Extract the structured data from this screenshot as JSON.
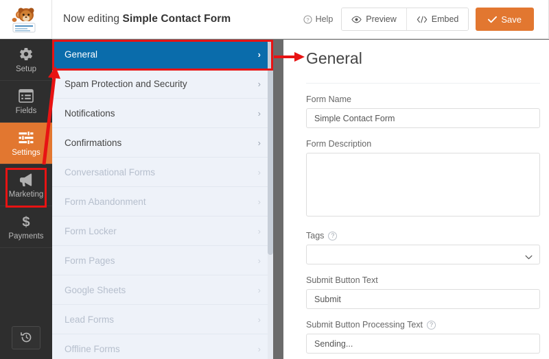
{
  "header": {
    "logo_alt": "wpforms-mascot-logo",
    "title_prefix": "Now editing ",
    "form_name": "Simple Contact Form",
    "help_label": "Help",
    "preview_label": "Preview",
    "embed_label": "Embed",
    "save_label": "Save",
    "save_color": "#e27730"
  },
  "rail": {
    "items": [
      {
        "label": "Setup",
        "icon": "gear-icon",
        "active": false
      },
      {
        "label": "Fields",
        "icon": "fields-list-icon",
        "active": false
      },
      {
        "label": "Settings",
        "icon": "sliders-icon",
        "active": true
      },
      {
        "label": "Marketing",
        "icon": "megaphone-icon",
        "active": false
      },
      {
        "label": "Payments",
        "icon": "dollar-icon",
        "active": false
      }
    ],
    "revision_icon": "revision-history-icon",
    "active_color": "#e27730"
  },
  "settings_list": {
    "active_color": "#0a6cab",
    "items": [
      {
        "label": "General",
        "state": "active"
      },
      {
        "label": "Spam Protection and Security",
        "state": "enabled"
      },
      {
        "label": "Notifications",
        "state": "enabled"
      },
      {
        "label": "Confirmations",
        "state": "enabled"
      },
      {
        "label": "Conversational Forms",
        "state": "disabled"
      },
      {
        "label": "Form Abandonment",
        "state": "disabled"
      },
      {
        "label": "Form Locker",
        "state": "disabled"
      },
      {
        "label": "Form Pages",
        "state": "disabled"
      },
      {
        "label": "Google Sheets",
        "state": "disabled"
      },
      {
        "label": "Lead Forms",
        "state": "disabled"
      },
      {
        "label": "Offline Forms",
        "state": "disabled"
      }
    ]
  },
  "content": {
    "title": "General",
    "fields": {
      "form_name_label": "Form Name",
      "form_name_value": "Simple Contact Form",
      "form_description_label": "Form Description",
      "form_description_value": "",
      "tags_label": "Tags",
      "tags_value": "",
      "submit_button_text_label": "Submit Button Text",
      "submit_button_text_value": "Submit",
      "submit_processing_label": "Submit Button Processing Text",
      "submit_processing_value": "Sending..."
    }
  },
  "annotations": {
    "highlight_color": "#e81313",
    "arrow_to_title": "arrow pointing from General tab to General heading",
    "arrow_to_settings": "arrow pointing from Settings rail button to General tab"
  }
}
